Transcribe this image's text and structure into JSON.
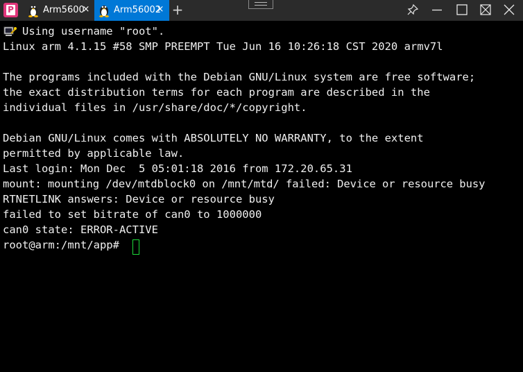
{
  "tabs": [
    {
      "label": "Arm5600",
      "close": "×",
      "icon": "linux-penguin-icon",
      "active": false
    },
    {
      "label": "Arm56002",
      "close": "×",
      "icon": "linux-penguin-icon",
      "active": true
    }
  ],
  "app_logo": "P",
  "new_tab": "+",
  "colors": {
    "titlebar_bg": "#2b2b2b",
    "active_tab_bg": "#0078d7",
    "terminal_bg": "#000000",
    "terminal_fg": "#f0f0f0",
    "cursor": "#1ddc3a",
    "logo": "#e0357a"
  },
  "terminal": {
    "lines": [
      "   Using username \"root\".",
      "Linux arm 4.1.15 #58 SMP PREEMPT Tue Jun 16 10:26:18 CST 2020 armv7l",
      "",
      "The programs included with the Debian GNU/Linux system are free software;",
      "the exact distribution terms for each program are described in the",
      "individual files in /usr/share/doc/*/copyright.",
      "",
      "Debian GNU/Linux comes with ABSOLUTELY NO WARRANTY, to the extent",
      "permitted by applicable law.",
      "Last login: Mon Dec  5 05:01:18 2016 from 172.20.65.31",
      "mount: mounting /dev/mtdblock0 on /mnt/mtd/ failed: Device or resource busy",
      "RTNETLINK answers: Device or resource busy",
      "failed to set bitrate of can0 to 1000000",
      "can0 state: ERROR-ACTIVE",
      "root@arm:/mnt/app# "
    ]
  }
}
